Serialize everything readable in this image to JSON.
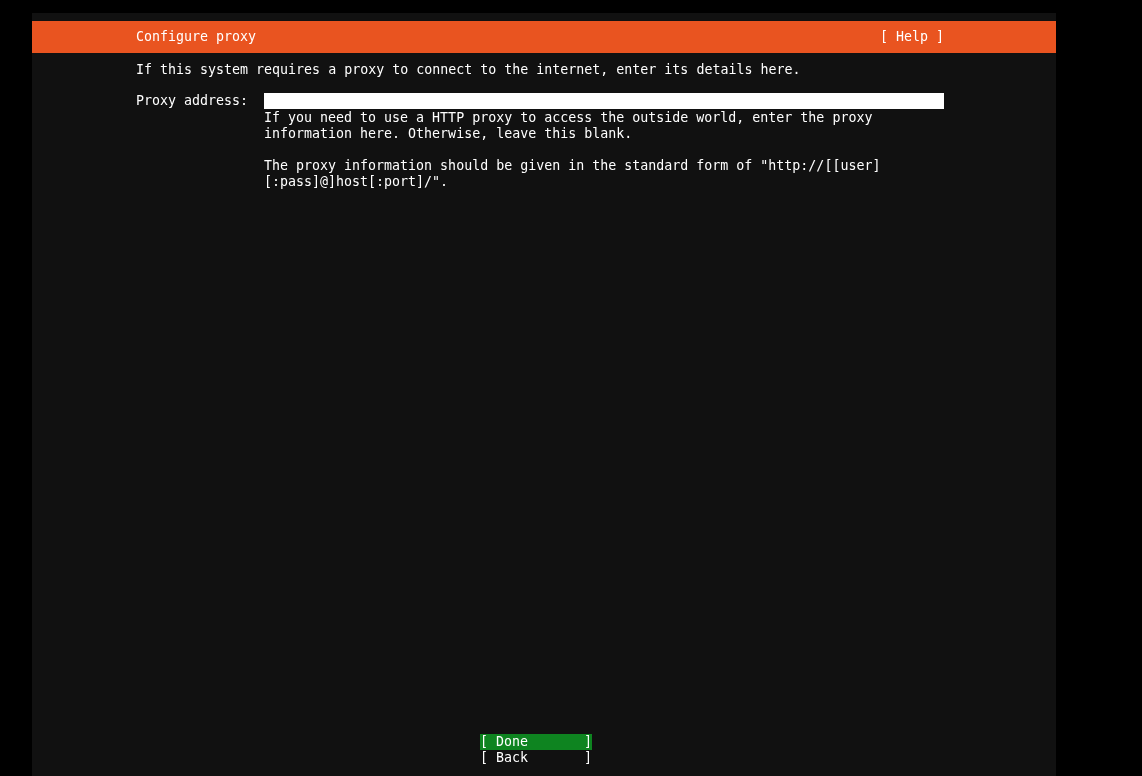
{
  "header": {
    "title": "Configure proxy",
    "help": "[ Help ]"
  },
  "intro": "If this system requires a proxy to connect to the internet, enter its details here.",
  "field": {
    "label": "Proxy address:",
    "help": [
      "If you need to use a HTTP proxy to access the outside world, enter the proxy information here. Otherwise, leave this blank.",
      "The proxy information should be given in the standard form of \"http://[[user][:pass]@]host[:port]/\"."
    ]
  },
  "buttons": [
    {
      "label": "[ Done       ]",
      "selected": true
    },
    {
      "label": "[ Back       ]",
      "selected": false
    }
  ]
}
